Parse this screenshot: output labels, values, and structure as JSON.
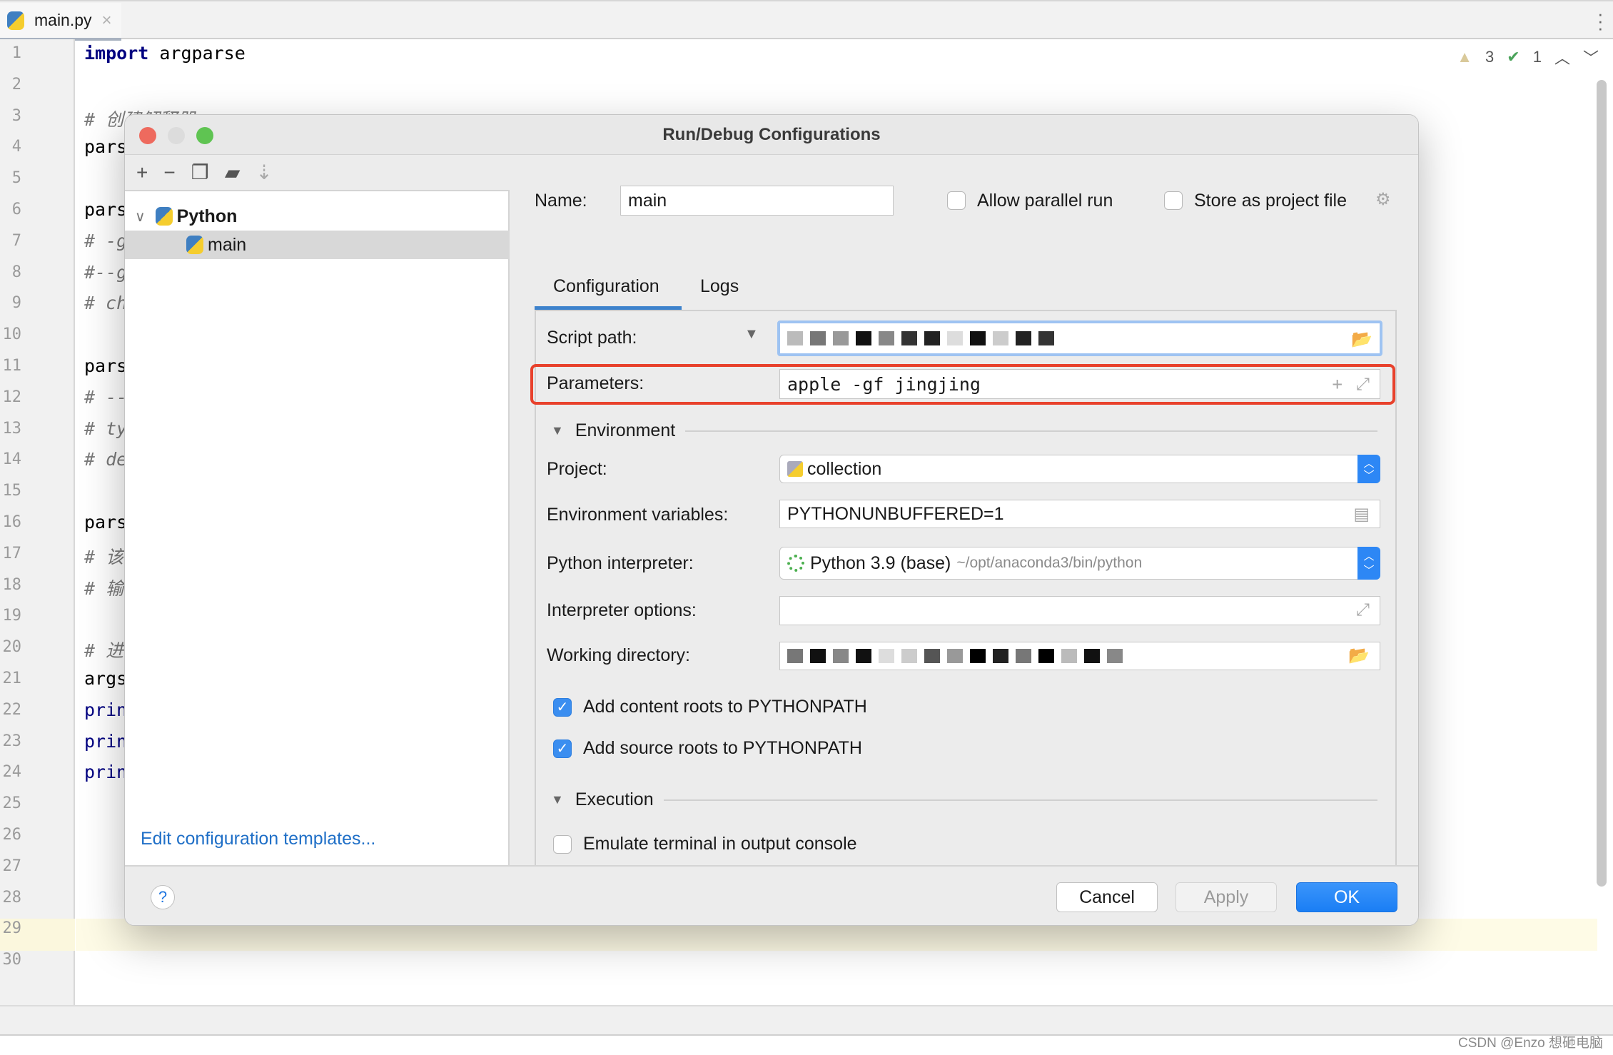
{
  "editor": {
    "tab": {
      "label": "main.py",
      "icon": "python-file-icon"
    },
    "inspections": {
      "warnings": "3",
      "weak_warnings": "1"
    },
    "lines": [
      {
        "n": "1",
        "parts": [
          {
            "t": "import",
            "c": "kw"
          },
          {
            "t": " argparse",
            "c": ""
          }
        ]
      },
      {
        "n": "2",
        "parts": []
      },
      {
        "n": "3",
        "parts": [
          {
            "t": "# 创建解释器",
            "c": "comment"
          }
        ]
      },
      {
        "n": "4",
        "parts": [
          {
            "t": "pars",
            "c": ""
          }
        ]
      },
      {
        "n": "5",
        "parts": []
      },
      {
        "n": "6",
        "parts": [
          {
            "t": "pars",
            "c": ""
          }
        ]
      },
      {
        "n": "7",
        "parts": [
          {
            "t": "# -g",
            "c": "comment"
          }
        ]
      },
      {
        "n": "8",
        "parts": [
          {
            "t": "#--g",
            "c": "comment"
          }
        ]
      },
      {
        "n": "9",
        "parts": [
          {
            "t": "# ch",
            "c": "comment"
          }
        ]
      },
      {
        "n": "10",
        "parts": []
      },
      {
        "n": "11",
        "parts": [
          {
            "t": "pars",
            "c": ""
          }
        ]
      },
      {
        "n": "12",
        "parts": [
          {
            "t": "# --",
            "c": "comment"
          }
        ]
      },
      {
        "n": "13",
        "parts": [
          {
            "t": "# ty",
            "c": "comment"
          }
        ]
      },
      {
        "n": "14",
        "parts": [
          {
            "t": "# de",
            "c": "comment"
          }
        ]
      },
      {
        "n": "15",
        "parts": []
      },
      {
        "n": "16",
        "parts": [
          {
            "t": "pars",
            "c": ""
          }
        ]
      },
      {
        "n": "17",
        "parts": [
          {
            "t": "# 该",
            "c": "comment"
          }
        ]
      },
      {
        "n": "18",
        "parts": [
          {
            "t": "# 输",
            "c": "comment"
          }
        ]
      },
      {
        "n": "19",
        "parts": []
      },
      {
        "n": "20",
        "parts": [
          {
            "t": "# 进",
            "c": "comment"
          }
        ]
      },
      {
        "n": "21",
        "parts": [
          {
            "t": "args",
            "c": ""
          }
        ]
      },
      {
        "n": "22",
        "parts": [
          {
            "t": "prin",
            "c": "fn"
          }
        ]
      },
      {
        "n": "23",
        "parts": [
          {
            "t": "prin",
            "c": "fn"
          }
        ]
      },
      {
        "n": "24",
        "parts": [
          {
            "t": "prin",
            "c": "fn"
          }
        ]
      },
      {
        "n": "25",
        "parts": []
      },
      {
        "n": "26",
        "parts": []
      },
      {
        "n": "27",
        "parts": []
      },
      {
        "n": "28",
        "parts": []
      },
      {
        "n": "29",
        "parts": []
      },
      {
        "n": "30",
        "parts": []
      }
    ]
  },
  "dialog": {
    "title": "Run/Debug Configurations",
    "tree": {
      "group": "Python",
      "item": "main"
    },
    "edit_templates": "Edit configuration templates...",
    "name_label": "Name:",
    "name_value": "main",
    "allow_parallel": "Allow parallel run",
    "store_project": "Store as project file",
    "tabs": [
      "Configuration",
      "Logs"
    ],
    "script_path_label": "Script path:",
    "parameters_label": "Parameters:",
    "parameters_value": "apple -gf jingjing",
    "environment_section": "Environment",
    "project_label": "Project:",
    "project_value": "collection",
    "env_vars_label": "Environment variables:",
    "env_vars_value": "PYTHONUNBUFFERED=1",
    "interpreter_label": "Python interpreter:",
    "interpreter_value": "Python 3.9 (base)",
    "interpreter_path": "~/opt/anaconda3/bin/python",
    "interp_options_label": "Interpreter options:",
    "interp_options_value": "",
    "workdir_label": "Working directory:",
    "content_roots": {
      "label": "Add content roots to PYTHONPATH",
      "checked": true
    },
    "source_roots": {
      "label": "Add source roots to PYTHONPATH",
      "checked": true
    },
    "execution_section": "Execution",
    "emulate_terminal": {
      "label": "Emulate terminal in output console",
      "checked": false
    },
    "buttons": {
      "cancel": "Cancel",
      "apply": "Apply",
      "ok": "OK",
      "help": "?"
    },
    "colors": {
      "accent": "#2d87f5",
      "highlight_box": "#e8412c",
      "link": "#1f6fc7"
    }
  },
  "watermark": "CSDN @Enzo 想砸电脑"
}
